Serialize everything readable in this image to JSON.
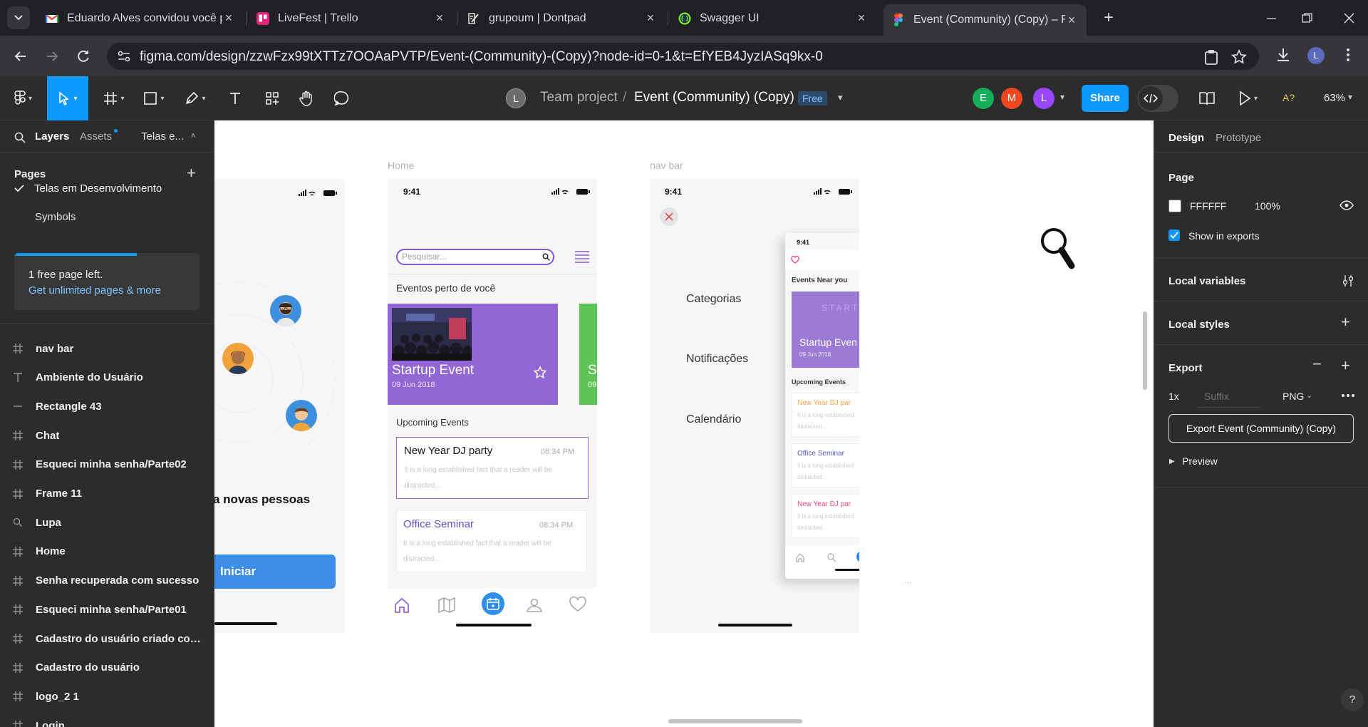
{
  "browser": {
    "tabs": [
      {
        "title": "Eduardo Alves convidou você p",
        "icon": "gmail-icon"
      },
      {
        "title": "LiveFest | Trello",
        "icon": "trello-icon"
      },
      {
        "title": "grupoum | Dontpad",
        "icon": "dontpad-icon"
      },
      {
        "title": "Swagger UI",
        "icon": "swagger-icon"
      },
      {
        "title": "Event (Community) (Copy) – Fig",
        "icon": "figma-icon"
      }
    ],
    "url": "figma.com/design/zzwFzx99tXTTz7OOAaPVTP/Event-(Community)-(Copy)?node-id=0-1&t=EfYEB4JyzIASq9kx-0",
    "profile_initial": "L"
  },
  "figma_toolbar": {
    "team_avatar": "L",
    "team": "Team project",
    "separator": "/",
    "file": "Event (Community) (Copy)",
    "plan_badge": "Free",
    "collaborators": [
      {
        "initial": "E",
        "color": "#14ae5c"
      },
      {
        "initial": "M",
        "color": "#f24822"
      },
      {
        "initial": "L",
        "color": "#9747ff"
      }
    ],
    "share_label": "Share",
    "font_warning": "A?",
    "zoom": "63%"
  },
  "left_panel": {
    "tabs": {
      "layers": "Layers",
      "assets": "Assets",
      "pages_dropdown": "Telas e..."
    },
    "pages_title": "Pages",
    "pages": [
      "Telas em Desenvolvimento",
      "Symbols"
    ],
    "free_notice": {
      "text": "1 free page left.",
      "link": "Get unlimited pages & more"
    },
    "layers": [
      {
        "name": "nav bar",
        "icon": "frame-icon"
      },
      {
        "name": "Ambiente do Usuário",
        "icon": "text-icon"
      },
      {
        "name": "Rectangle 43",
        "icon": "line-icon"
      },
      {
        "name": "Chat",
        "icon": "frame-icon"
      },
      {
        "name": "Esqueci minha senha/Parte02",
        "icon": "frame-icon"
      },
      {
        "name": "Frame 11",
        "icon": "frame-icon"
      },
      {
        "name": "Lupa",
        "icon": "search-icon"
      },
      {
        "name": "Home",
        "icon": "frame-icon"
      },
      {
        "name": "Senha recuperada com sucesso",
        "icon": "frame-icon"
      },
      {
        "name": "Esqueci minha senha/Parte01",
        "icon": "frame-icon"
      },
      {
        "name": "Cadastro do usuário criado com s...",
        "icon": "frame-icon"
      },
      {
        "name": "Cadastro do usuário",
        "icon": "frame-icon"
      },
      {
        "name": "logo_2 1",
        "icon": "frame-icon"
      },
      {
        "name": "Login",
        "icon": "frame-icon"
      }
    ]
  },
  "canvas": {
    "frame1": {
      "time": "",
      "partial_text": "a novas pessoas",
      "button": "Iniciar"
    },
    "home": {
      "label": "Home",
      "time": "9:41",
      "search_placeholder": "Pesquisar...",
      "section_nearby": "Eventos perto de você",
      "card": {
        "title": "Startup Event",
        "date": "09 Jun 2018"
      },
      "card2_partial": {
        "title": "S",
        "date": "09"
      },
      "section_upcoming": "Upcoming Events",
      "events": [
        {
          "title": "New Year DJ party",
          "time": "08:34 PM",
          "desc": "It is a long established fact that a reader will be distracted...",
          "color": "#111111"
        },
        {
          "title": "Office Seminar",
          "time": "08:34 PM",
          "desc": "It is a long established fact that a reader will be distracted...",
          "color": "#5b53d6"
        }
      ]
    },
    "navbar": {
      "label": "nav bar",
      "time": "9:41",
      "menu": [
        "Categorias",
        "Notificações",
        "Calendário"
      ],
      "mini": {
        "time": "9:41",
        "near": "Events Near you",
        "card_title": "Startup Even",
        "card_date": "09 Jun 2018",
        "card_watermark": "START",
        "upcoming": "Upcoming Events",
        "events": [
          {
            "title": "New Year DJ par",
            "color": "#f4a340"
          },
          {
            "title": "Office Seminar",
            "color": "#5b53d6"
          },
          {
            "title": "New Year DJ par",
            "color": "#f0427c"
          }
        ],
        "desc_line1": "It is a long established",
        "desc_line2": "distracted..."
      }
    },
    "ellipsis": "..."
  },
  "right_panel": {
    "tabs": {
      "design": "Design",
      "prototype": "Prototype"
    },
    "page_title": "Page",
    "page_color": "FFFFFF",
    "page_opacity": "100%",
    "show_in_exports": "Show in exports",
    "local_variables": "Local variables",
    "local_styles": "Local styles",
    "export_title": "Export",
    "export_scale": "1x",
    "export_suffix_placeholder": "Suffix",
    "export_format": "PNG",
    "export_button": "Export Event (Community) (Copy)",
    "preview": "Preview",
    "help": "?"
  }
}
